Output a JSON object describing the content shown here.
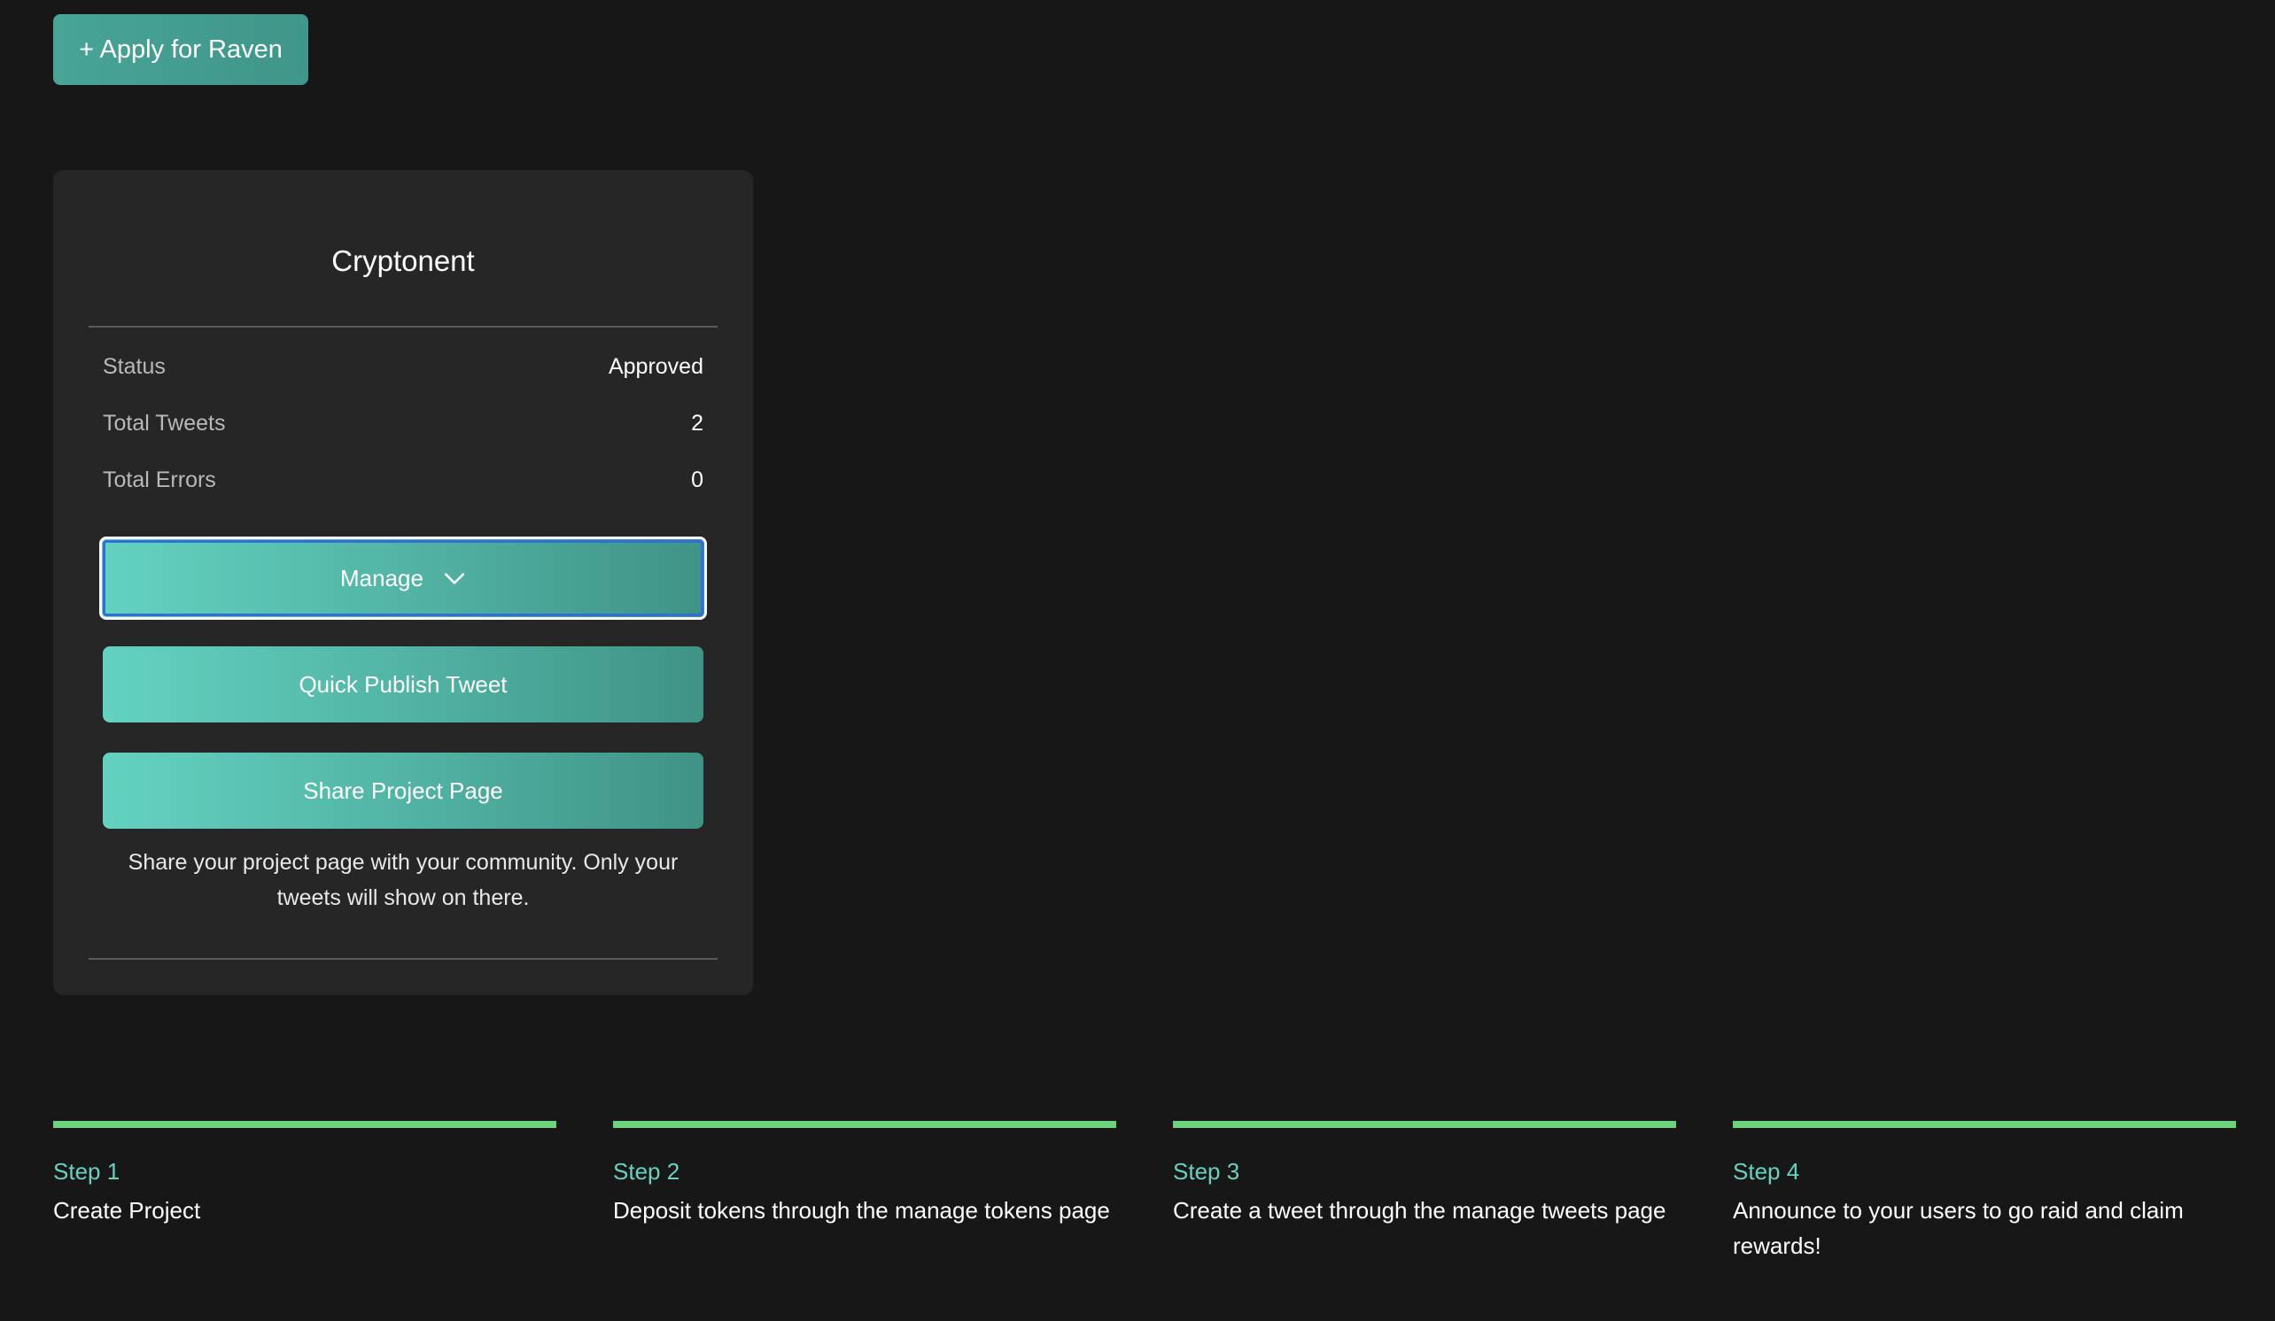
{
  "header": {
    "apply_button": "+ Apply for Raven"
  },
  "project_card": {
    "title": "Cryptonent",
    "stats": [
      {
        "label": "Status",
        "value": "Approved"
      },
      {
        "label": "Total Tweets",
        "value": "2"
      },
      {
        "label": "Total Errors",
        "value": "0"
      }
    ],
    "manage_button": "Manage",
    "quick_publish_button": "Quick Publish Tweet",
    "share_button": "Share Project Page",
    "share_description": "Share your project page with your community. Only your tweets will show on there."
  },
  "steps": [
    {
      "label": "Step 1",
      "text": "Create Project"
    },
    {
      "label": "Step 2",
      "text": "Deposit tokens through the manage tokens page"
    },
    {
      "label": "Step 3",
      "text": "Create a tweet through the manage tweets page"
    },
    {
      "label": "Step 4",
      "text": "Announce to your users to go raid and claim rewards!"
    }
  ],
  "colors": {
    "background": "#171717",
    "card": "#262626",
    "accent": "#4fb3a4",
    "step_bar": "#6fd37e",
    "step_label": "#6ad1c0"
  }
}
